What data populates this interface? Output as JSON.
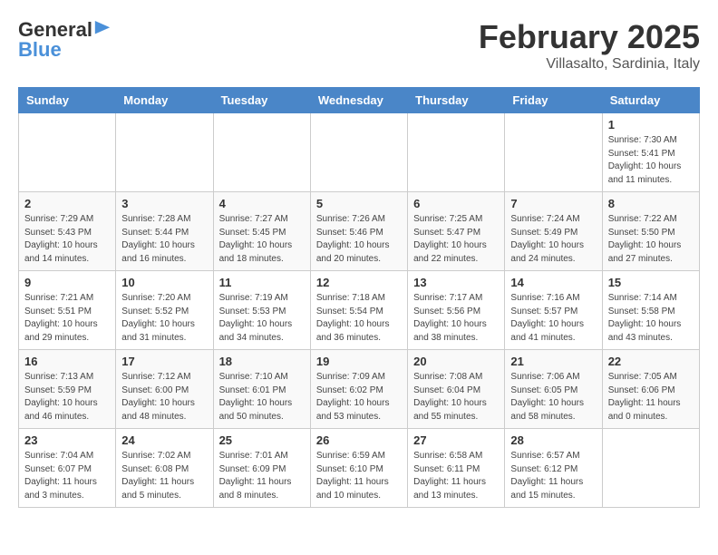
{
  "logo": {
    "general": "General",
    "blue": "Blue"
  },
  "title": {
    "month_year": "February 2025",
    "location": "Villasalto, Sardinia, Italy"
  },
  "header_days": [
    "Sunday",
    "Monday",
    "Tuesday",
    "Wednesday",
    "Thursday",
    "Friday",
    "Saturday"
  ],
  "weeks": [
    [
      {
        "day": "",
        "info": ""
      },
      {
        "day": "",
        "info": ""
      },
      {
        "day": "",
        "info": ""
      },
      {
        "day": "",
        "info": ""
      },
      {
        "day": "",
        "info": ""
      },
      {
        "day": "",
        "info": ""
      },
      {
        "day": "1",
        "info": "Sunrise: 7:30 AM\nSunset: 5:41 PM\nDaylight: 10 hours\nand 11 minutes."
      }
    ],
    [
      {
        "day": "2",
        "info": "Sunrise: 7:29 AM\nSunset: 5:43 PM\nDaylight: 10 hours\nand 14 minutes."
      },
      {
        "day": "3",
        "info": "Sunrise: 7:28 AM\nSunset: 5:44 PM\nDaylight: 10 hours\nand 16 minutes."
      },
      {
        "day": "4",
        "info": "Sunrise: 7:27 AM\nSunset: 5:45 PM\nDaylight: 10 hours\nand 18 minutes."
      },
      {
        "day": "5",
        "info": "Sunrise: 7:26 AM\nSunset: 5:46 PM\nDaylight: 10 hours\nand 20 minutes."
      },
      {
        "day": "6",
        "info": "Sunrise: 7:25 AM\nSunset: 5:47 PM\nDaylight: 10 hours\nand 22 minutes."
      },
      {
        "day": "7",
        "info": "Sunrise: 7:24 AM\nSunset: 5:49 PM\nDaylight: 10 hours\nand 24 minutes."
      },
      {
        "day": "8",
        "info": "Sunrise: 7:22 AM\nSunset: 5:50 PM\nDaylight: 10 hours\nand 27 minutes."
      }
    ],
    [
      {
        "day": "9",
        "info": "Sunrise: 7:21 AM\nSunset: 5:51 PM\nDaylight: 10 hours\nand 29 minutes."
      },
      {
        "day": "10",
        "info": "Sunrise: 7:20 AM\nSunset: 5:52 PM\nDaylight: 10 hours\nand 31 minutes."
      },
      {
        "day": "11",
        "info": "Sunrise: 7:19 AM\nSunset: 5:53 PM\nDaylight: 10 hours\nand 34 minutes."
      },
      {
        "day": "12",
        "info": "Sunrise: 7:18 AM\nSunset: 5:54 PM\nDaylight: 10 hours\nand 36 minutes."
      },
      {
        "day": "13",
        "info": "Sunrise: 7:17 AM\nSunset: 5:56 PM\nDaylight: 10 hours\nand 38 minutes."
      },
      {
        "day": "14",
        "info": "Sunrise: 7:16 AM\nSunset: 5:57 PM\nDaylight: 10 hours\nand 41 minutes."
      },
      {
        "day": "15",
        "info": "Sunrise: 7:14 AM\nSunset: 5:58 PM\nDaylight: 10 hours\nand 43 minutes."
      }
    ],
    [
      {
        "day": "16",
        "info": "Sunrise: 7:13 AM\nSunset: 5:59 PM\nDaylight: 10 hours\nand 46 minutes."
      },
      {
        "day": "17",
        "info": "Sunrise: 7:12 AM\nSunset: 6:00 PM\nDaylight: 10 hours\nand 48 minutes."
      },
      {
        "day": "18",
        "info": "Sunrise: 7:10 AM\nSunset: 6:01 PM\nDaylight: 10 hours\nand 50 minutes."
      },
      {
        "day": "19",
        "info": "Sunrise: 7:09 AM\nSunset: 6:02 PM\nDaylight: 10 hours\nand 53 minutes."
      },
      {
        "day": "20",
        "info": "Sunrise: 7:08 AM\nSunset: 6:04 PM\nDaylight: 10 hours\nand 55 minutes."
      },
      {
        "day": "21",
        "info": "Sunrise: 7:06 AM\nSunset: 6:05 PM\nDaylight: 10 hours\nand 58 minutes."
      },
      {
        "day": "22",
        "info": "Sunrise: 7:05 AM\nSunset: 6:06 PM\nDaylight: 11 hours\nand 0 minutes."
      }
    ],
    [
      {
        "day": "23",
        "info": "Sunrise: 7:04 AM\nSunset: 6:07 PM\nDaylight: 11 hours\nand 3 minutes."
      },
      {
        "day": "24",
        "info": "Sunrise: 7:02 AM\nSunset: 6:08 PM\nDaylight: 11 hours\nand 5 minutes."
      },
      {
        "day": "25",
        "info": "Sunrise: 7:01 AM\nSunset: 6:09 PM\nDaylight: 11 hours\nand 8 minutes."
      },
      {
        "day": "26",
        "info": "Sunrise: 6:59 AM\nSunset: 6:10 PM\nDaylight: 11 hours\nand 10 minutes."
      },
      {
        "day": "27",
        "info": "Sunrise: 6:58 AM\nSunset: 6:11 PM\nDaylight: 11 hours\nand 13 minutes."
      },
      {
        "day": "28",
        "info": "Sunrise: 6:57 AM\nSunset: 6:12 PM\nDaylight: 11 hours\nand 15 minutes."
      },
      {
        "day": "",
        "info": ""
      }
    ]
  ]
}
